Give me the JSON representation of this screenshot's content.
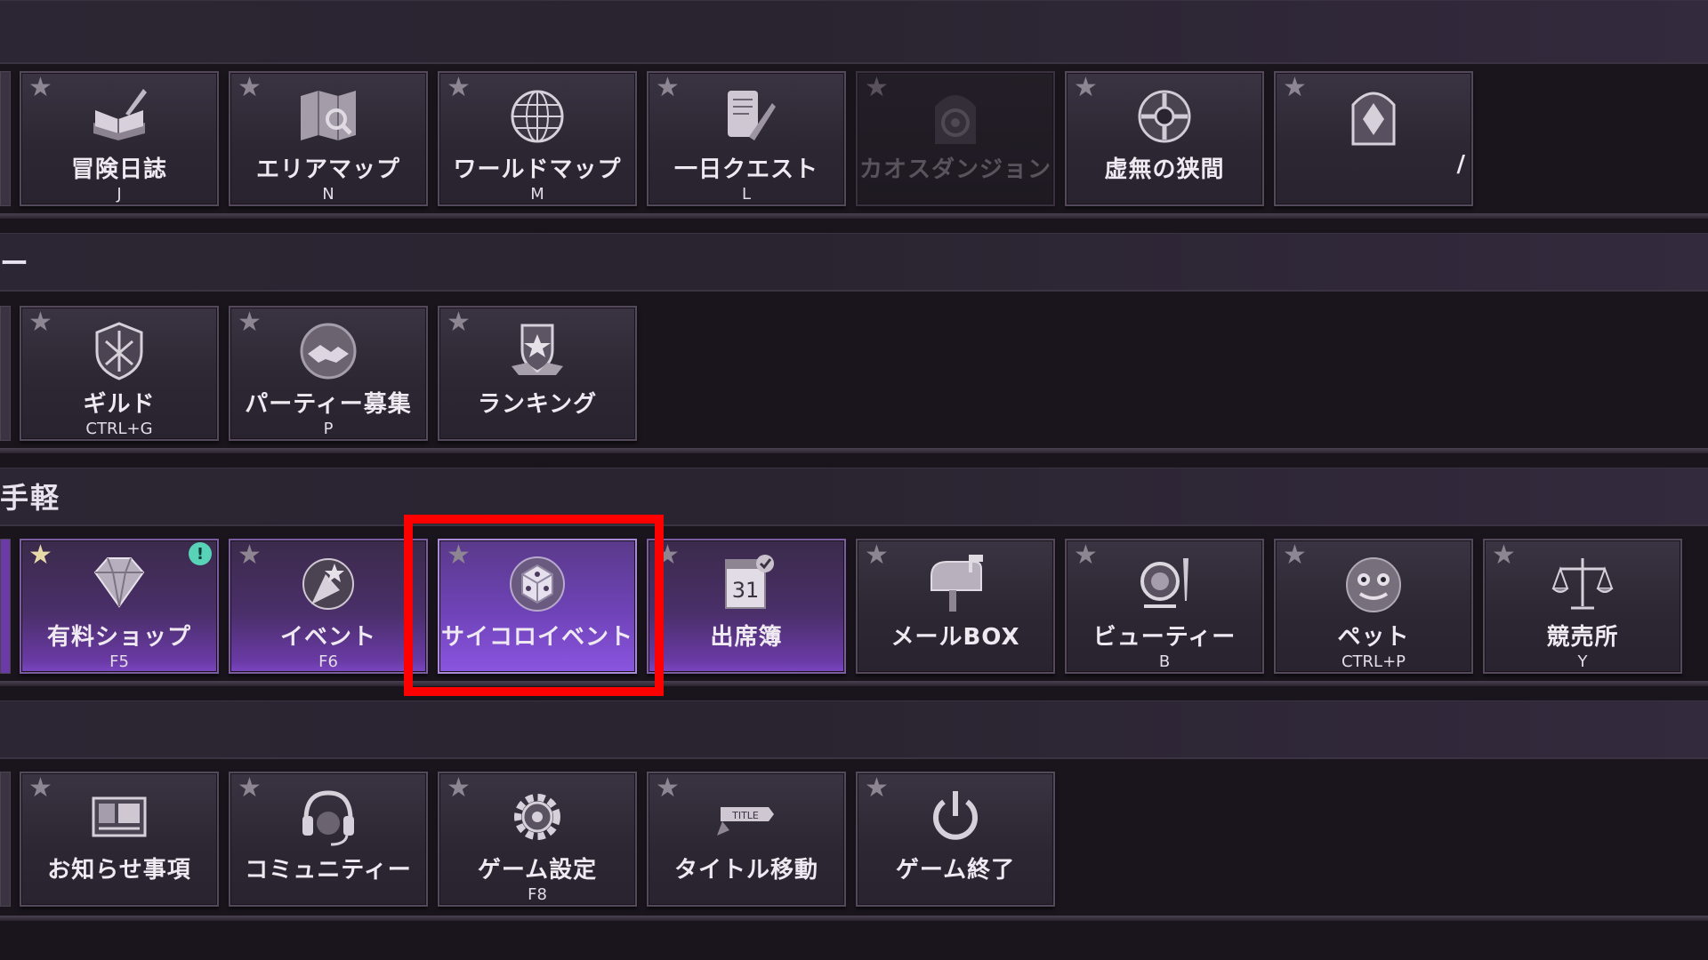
{
  "sections": [
    {
      "heading": "",
      "tiles": [
        {
          "label": "冒険日誌",
          "key": "J",
          "icon": "book-quill-icon"
        },
        {
          "label": "エリアマップ",
          "key": "N",
          "icon": "area-map-icon"
        },
        {
          "label": "ワールドマップ",
          "key": "M",
          "icon": "globe-icon"
        },
        {
          "label": "一日クエスト",
          "key": "L",
          "icon": "scroll-quill-icon"
        },
        {
          "label": "カオスダンジョン",
          "key": "",
          "icon": "chaos-portal-icon",
          "disabled": true
        },
        {
          "label": "虚無の狭間",
          "key": "",
          "icon": "void-rift-icon"
        },
        {
          "label": "/",
          "key": "",
          "icon": "gate-icon"
        }
      ]
    },
    {
      "heading": "ー",
      "tiles": [
        {
          "label": "ギルド",
          "key": "CTRL+G",
          "icon": "guild-shield-icon"
        },
        {
          "label": "パーティー募集",
          "key": "P",
          "icon": "handshake-icon"
        },
        {
          "label": "ランキング",
          "key": "",
          "icon": "ranking-emblem-icon"
        }
      ]
    },
    {
      "heading": "手軽",
      "tiles": [
        {
          "label": "有料ショップ",
          "key": "F5",
          "icon": "diamond-icon",
          "badge": "!",
          "gold_star": true
        },
        {
          "label": "イベント",
          "key": "F6",
          "icon": "party-popper-icon"
        },
        {
          "label": "サイコロイベント",
          "key": "",
          "icon": "dice-icon",
          "selected": true
        },
        {
          "label": "出席簿",
          "key": "",
          "icon": "calendar-check-icon"
        },
        {
          "label": "メールBOX",
          "key": "",
          "icon": "mailbox-icon"
        },
        {
          "label": "ビューティー",
          "key": "B",
          "icon": "beauty-mirror-icon"
        },
        {
          "label": "ペット",
          "key": "CTRL+P",
          "icon": "pet-icon"
        },
        {
          "label": "競売所",
          "key": "Y",
          "icon": "scales-icon"
        }
      ]
    },
    {
      "heading": "",
      "tiles": [
        {
          "label": "お知らせ事項",
          "key": "",
          "icon": "notice-board-icon"
        },
        {
          "label": "コミュニティー",
          "key": "",
          "icon": "headset-icon"
        },
        {
          "label": "ゲーム設定",
          "key": "F8",
          "icon": "gear-icon"
        },
        {
          "label": "タイトル移動",
          "key": "",
          "icon": "title-banner-icon"
        },
        {
          "label": "ゲーム終了",
          "key": "",
          "icon": "power-icon"
        }
      ]
    }
  ],
  "calendar_day": "31",
  "title_banner_text": "TITLE",
  "highlight_color": "#ff0000",
  "accent_purple": "#7b47c2"
}
